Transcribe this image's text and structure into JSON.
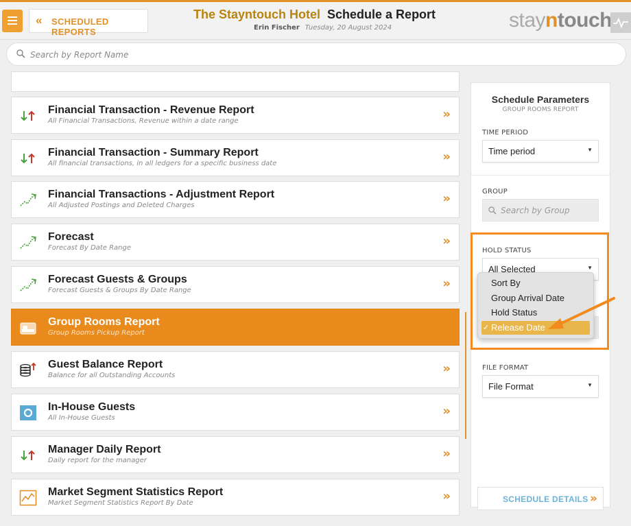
{
  "header": {
    "back_label": "SCHEDULED REPORTS",
    "hotel_name": "The Stayntouch Hotel",
    "page_title": "Schedule a Report",
    "user": "Erin Fischer",
    "date": "Tuesday, 20 August 2024",
    "logo": {
      "part1": "stay",
      "part2": "n",
      "part3": "touch"
    }
  },
  "search": {
    "placeholder": "Search by Report Name"
  },
  "reports": [
    {
      "title": "Financial Transaction - Revenue Report",
      "desc": "All Financial Transactions, Revenue within a date range",
      "icon": "up-down-arrows-icon"
    },
    {
      "title": "Financial Transaction - Summary Report",
      "desc": "All financial transactions, in all ledgers for a specific business date",
      "icon": "up-down-arrows-icon"
    },
    {
      "title": "Financial Transactions - Adjustment Report",
      "desc": "All Adjusted Postings and Deleted Charges",
      "icon": "trend-line-icon"
    },
    {
      "title": "Forecast",
      "desc": "Forecast By Date Range",
      "icon": "trend-line-icon"
    },
    {
      "title": "Forecast Guests & Groups",
      "desc": "Forecast Guests & Groups By Date Range",
      "icon": "trend-line-icon"
    },
    {
      "title": "Group Rooms Report",
      "desc": "Group Rooms Pickup Report",
      "icon": "bed-icon",
      "selected": true
    },
    {
      "title": "Guest Balance Report",
      "desc": "Balance for all Outstanding Accounts",
      "icon": "coins-icon"
    },
    {
      "title": "In-House Guests",
      "desc": "All In-House Guests",
      "icon": "in-house-icon"
    },
    {
      "title": "Manager Daily Report",
      "desc": "Daily report for the manager",
      "icon": "up-down-arrows-icon"
    },
    {
      "title": "Market Segment Statistics Report",
      "desc": "Market Segment Statistics Report By Date",
      "icon": "chart-icon"
    }
  ],
  "panel": {
    "title": "Schedule Parameters",
    "subtitle": "GROUP ROOMS REPORT",
    "time_period_label": "TIME PERIOD",
    "time_period_value": "Time period",
    "group_label": "GROUP",
    "group_placeholder": "Search by Group",
    "hold_status_label": "HOLD STATUS",
    "hold_status_value": "All Selected",
    "file_format_label": "FILE FORMAT",
    "file_format_value": "File Format",
    "schedule_button": "SCHEDULE DETAILS"
  },
  "dropdown": {
    "options": [
      "Sort By",
      "Group Arrival Date",
      "Hold Status",
      "Release Date"
    ],
    "selected": "Release Date"
  },
  "colors": {
    "accent": "#e0912a",
    "selected_row": "#e88b1c",
    "highlight": "#f28a1e",
    "link_blue": "#6bb3d6"
  }
}
